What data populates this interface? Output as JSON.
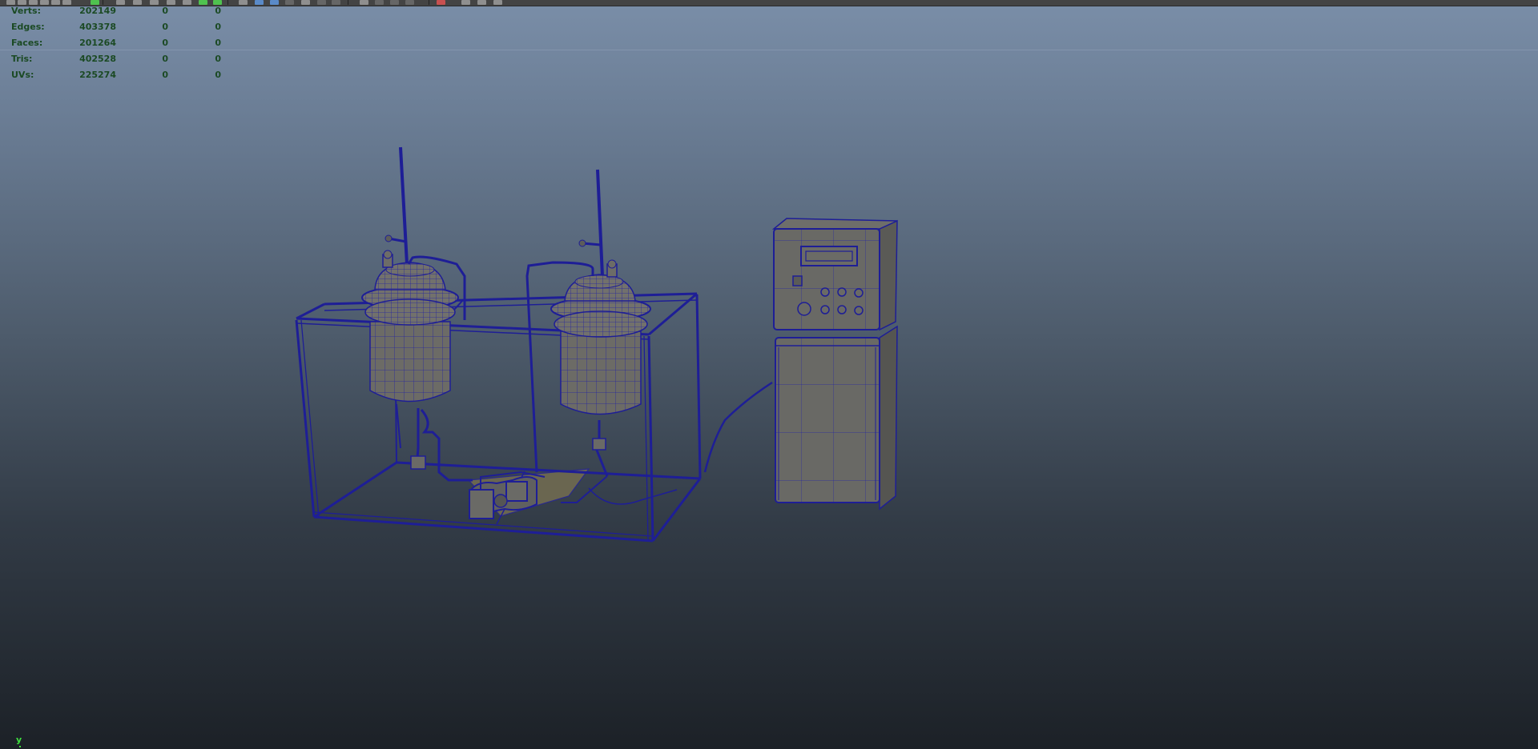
{
  "heads_up_display": {
    "rows": [
      {
        "label": "Verts:",
        "total": "202149",
        "selected": "0",
        "component": "0"
      },
      {
        "label": "Edges:",
        "total": "403378",
        "selected": "0",
        "component": "0"
      },
      {
        "label": "Faces:",
        "total": "201264",
        "selected": "0",
        "component": "0"
      },
      {
        "label": "Tris:",
        "total": "402528",
        "selected": "0",
        "component": "0"
      },
      {
        "label": "UVs:",
        "total": "225274",
        "selected": "0",
        "component": "0"
      }
    ]
  },
  "view_axis": {
    "label": "y"
  },
  "toolbar": {
    "icons": [
      "select-tool-icon",
      "lasso-tool-icon",
      "paint-select-icon",
      "move-tool-icon",
      "rotate-tool-icon",
      "scale-tool-icon",
      "grid-icon",
      "camera-icon",
      "film-gate-icon",
      "resolution-gate-icon",
      "safe-action-icon",
      "wireframe-icon",
      "shaded-icon",
      "smooth-shade-icon",
      "textured-icon",
      "lights-icon",
      "shadows-icon",
      "isolate-icon",
      "xray-icon",
      "manipulator-icon"
    ]
  },
  "colors": {
    "viewport_top": "#7a8ea8",
    "viewport_bottom": "#1c2127",
    "wireframe": "#1e1e96",
    "mesh_fill": "#6a6a68",
    "hud_text": "#1b4a24",
    "axis_green": "#3fe03f"
  }
}
